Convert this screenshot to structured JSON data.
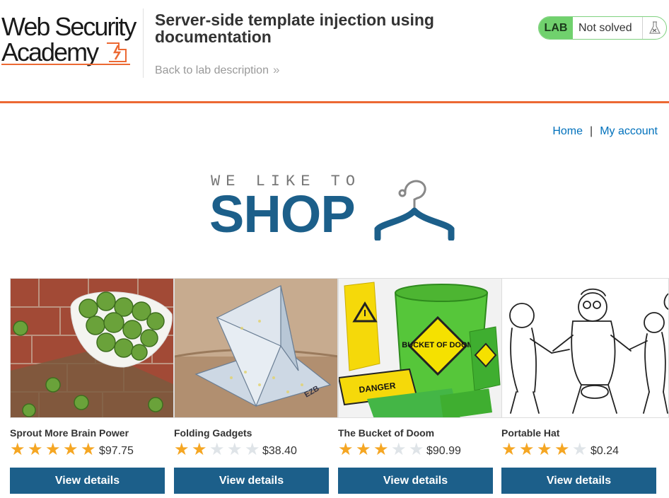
{
  "academy": {
    "logo_line1": "Web Security",
    "logo_line2": "Academy",
    "lab_title": "Server-side template injection using documentation",
    "back_link": "Back to lab description",
    "lab_badge": "LAB",
    "status": "Not solved"
  },
  "nav": {
    "home": "Home",
    "separator": "|",
    "my_account": "My account"
  },
  "banner": {
    "tagline": "WE LIKE TO",
    "word": "SHOP"
  },
  "colors": {
    "accent_orange": "#ec6933",
    "brand_blue": "#1c5f8a",
    "link_blue": "#0071bc",
    "lab_green": "#70d16d",
    "star_gold": "#f5a623"
  },
  "products": [
    {
      "name": "Sprout More Brain Power",
      "rating": 5,
      "price": "$97.75",
      "button": "View details"
    },
    {
      "name": "Folding Gadgets",
      "rating": 2,
      "price": "$38.40",
      "button": "View details"
    },
    {
      "name": "The Bucket of Doom",
      "rating": 3,
      "price": "$90.99",
      "button": "View details"
    },
    {
      "name": "Portable Hat",
      "rating": 4,
      "price": "$0.24",
      "button": "View details"
    }
  ],
  "product_images": [
    {
      "label1": "",
      "label2": ""
    },
    {
      "label1": "EZB",
      "label2": ""
    },
    {
      "label1": "BUCKET OF DOOM",
      "label2": "DANGER"
    },
    {
      "label1": "",
      "label2": ""
    }
  ]
}
